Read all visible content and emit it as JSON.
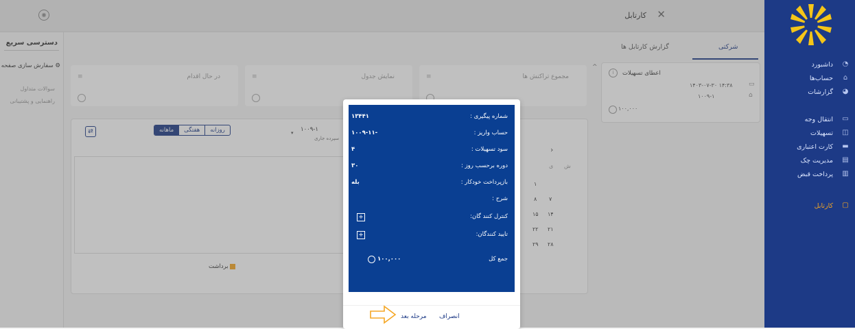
{
  "app": {
    "title": "کارتابل"
  },
  "sidebar": {
    "items": [
      {
        "label": "داشبورد",
        "icon": "dashboard-icon"
      },
      {
        "label": "حساب‌ها",
        "icon": "bank-icon"
      },
      {
        "label": "گزارشات",
        "icon": "chart-icon"
      },
      {
        "label": "انتقال وجه",
        "icon": "transfer-icon"
      },
      {
        "label": "تسهیلات",
        "icon": "loan-icon"
      },
      {
        "label": "کارت اعتباری",
        "icon": "credit-card-icon"
      },
      {
        "label": "مدیریت چک",
        "icon": "check-icon"
      },
      {
        "label": "پرداخت قبض",
        "icon": "bill-icon"
      },
      {
        "label": "کارتابل",
        "icon": "cartable-icon"
      }
    ]
  },
  "quick_access": {
    "title": "دسترسی سریع",
    "customize_label": "سفارش سازی صفحه",
    "faq_label": "سوالات متداول",
    "support_label": "راهنمایی و پشتیبانی"
  },
  "tabs": {
    "company": "شرکتی",
    "report": "گزارش کارتابل ها"
  },
  "card": {
    "title": "اعطای تسهیلات",
    "date": "۱۴۰۳-۰۷-۳۰ ۱۴:۳۸",
    "account": "۱۰۰۹-۱",
    "amount": "۱۰۰,۰۰۰"
  },
  "summary_cards": [
    {
      "title": "مجموع تراکنش ها"
    },
    {
      "title": "نمایش جدول"
    },
    {
      "title": "در حال اقدام"
    }
  ],
  "chart_panel": {
    "account_select": "۱۰۰۹-۱",
    "account_sub": "سپرده جاری",
    "period_tabs": [
      "روزانه",
      "هفتگی",
      "ماهانه"
    ],
    "legend_withdraw": "برداشت"
  },
  "calendar": {
    "days_header": [
      "ش",
      "ی"
    ],
    "rows": [
      [
        "۱",
        ""
      ],
      [
        "۷",
        "۸"
      ],
      [
        "۱۴",
        "۱۵"
      ],
      [
        "۲۱",
        "۲۲"
      ],
      [
        "۲۸",
        "۲۹"
      ]
    ]
  },
  "modal": {
    "rows": [
      {
        "label": "شماره پیگیری :",
        "value": "۱۳۴۴۱"
      },
      {
        "label": "حساب واریز :",
        "value": "۱۰۰۹-۱۱-"
      },
      {
        "label": "سود تسهیلات :",
        "value": "۴"
      },
      {
        "label": "دوره برحسب روز :",
        "value": "۳۰"
      },
      {
        "label": "بازپرداخت خودکار :",
        "value": "بله"
      },
      {
        "label": "شرح :",
        "value": ""
      },
      {
        "label": "کنترل کنند گان:",
        "value": ""
      },
      {
        "label": "تایید کنندگان:",
        "value": ""
      },
      {
        "label": "جمع کل",
        "value": "۱۰۰,۰۰۰"
      }
    ],
    "next_label": "مرحله بعد",
    "cancel_label": "انصراف"
  },
  "colors": {
    "sidebar_bg": "#1d3a86",
    "modal_blue": "#0a3f92",
    "accent_orange": "#f5a623",
    "tab_underline": "#1d3a86"
  }
}
